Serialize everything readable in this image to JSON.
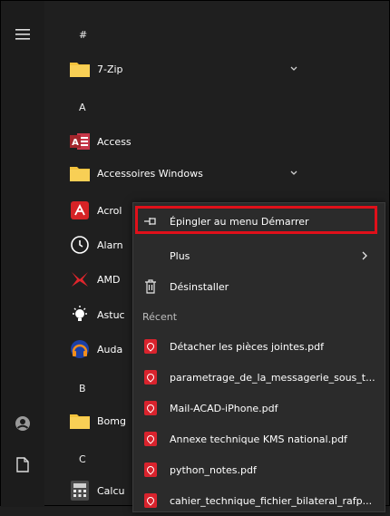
{
  "colors": {
    "background": "#1f1f1f",
    "menu_background": "#2b2b2b",
    "highlight_border": "#e0101a",
    "folder_yellow": "#f3c23c",
    "pdf_red": "#d9232d"
  },
  "rail": {
    "menu_icon": "hamburger-icon",
    "user_icon": "user-icon",
    "documents_icon": "document-icon"
  },
  "list": {
    "headers": [
      "#",
      "A",
      "B",
      "C"
    ],
    "items": [
      {
        "label": "7-Zip",
        "icon": "folder-icon"
      },
      {
        "label": "Access",
        "icon": "access-icon"
      },
      {
        "label": "Accessoires Windows",
        "icon": "folder-icon"
      },
      {
        "label": "Acrol",
        "icon": "acrobat-icon"
      },
      {
        "label": "Alarn",
        "icon": "alarm-icon"
      },
      {
        "label": "AMD",
        "icon": "amd-icon"
      },
      {
        "label": "Astuc",
        "icon": "tips-icon"
      },
      {
        "label": "Auda",
        "icon": "audacity-icon"
      },
      {
        "label": "Bomg",
        "icon": "folder-icon"
      },
      {
        "label": "Calcu",
        "icon": "calculator-icon"
      }
    ]
  },
  "context_menu": {
    "pin_label": "Épingler au menu Démarrer",
    "more_label": "Plus",
    "uninstall_label": "Désinstaller",
    "recent_header": "Récent",
    "recent_files": [
      "Détacher les pièces jointes.pdf",
      "parametrage_de_la_messagerie_sous_t...",
      "Mail-ACAD-iPhone.pdf",
      "Annexe technique KMS national.pdf",
      "python_notes.pdf",
      "cahier_technique_fichier_bilateral_rafp..."
    ]
  }
}
